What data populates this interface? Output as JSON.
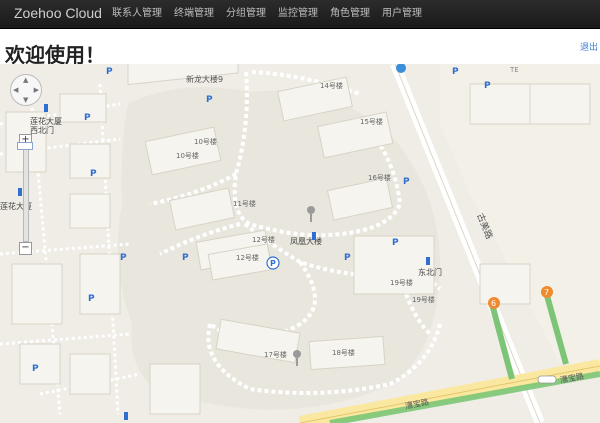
{
  "navbar": {
    "brand": "Zoehoo Cloud",
    "items": [
      "联系人管理",
      "终端管理",
      "分组管理",
      "监控管理",
      "角色管理",
      "用户管理"
    ]
  },
  "page": {
    "welcome": "欢迎使用！",
    "logout": "退出"
  },
  "map": {
    "labels": {
      "xinlong": "新龙大楼9",
      "te": "TE",
      "bldg14": "14号楼",
      "bldg15": "15号楼",
      "bldg10a": "10号楼",
      "bldg10b": "10号楼",
      "bldg16": "16号楼",
      "bldg11": "11号楼",
      "bldg12a": "12号楼",
      "bldg12b": "12号楼",
      "fenghuang": "凤凰大楼",
      "dongbeimen1": "东北门",
      "bldg19a": "19号楼",
      "bldg19b": "19号楼",
      "bldg17": "17号楼",
      "bldg18": "18号楼",
      "lianhua": "莲花大厦",
      "xibeimen": "西北门",
      "lianhua2": "莲花大厦",
      "gumeilu": "古美路",
      "caobaolu1": "漕宝路",
      "caobaolu2": "漕宝路"
    },
    "pins": [
      "6",
      "7"
    ],
    "zoom": {
      "plus": "+",
      "minus": "−"
    }
  },
  "colors": {
    "navbar": "#1f1f1f",
    "parking": "#2f6fd1",
    "route": "#7cc576",
    "pin": "#f08a2e"
  }
}
